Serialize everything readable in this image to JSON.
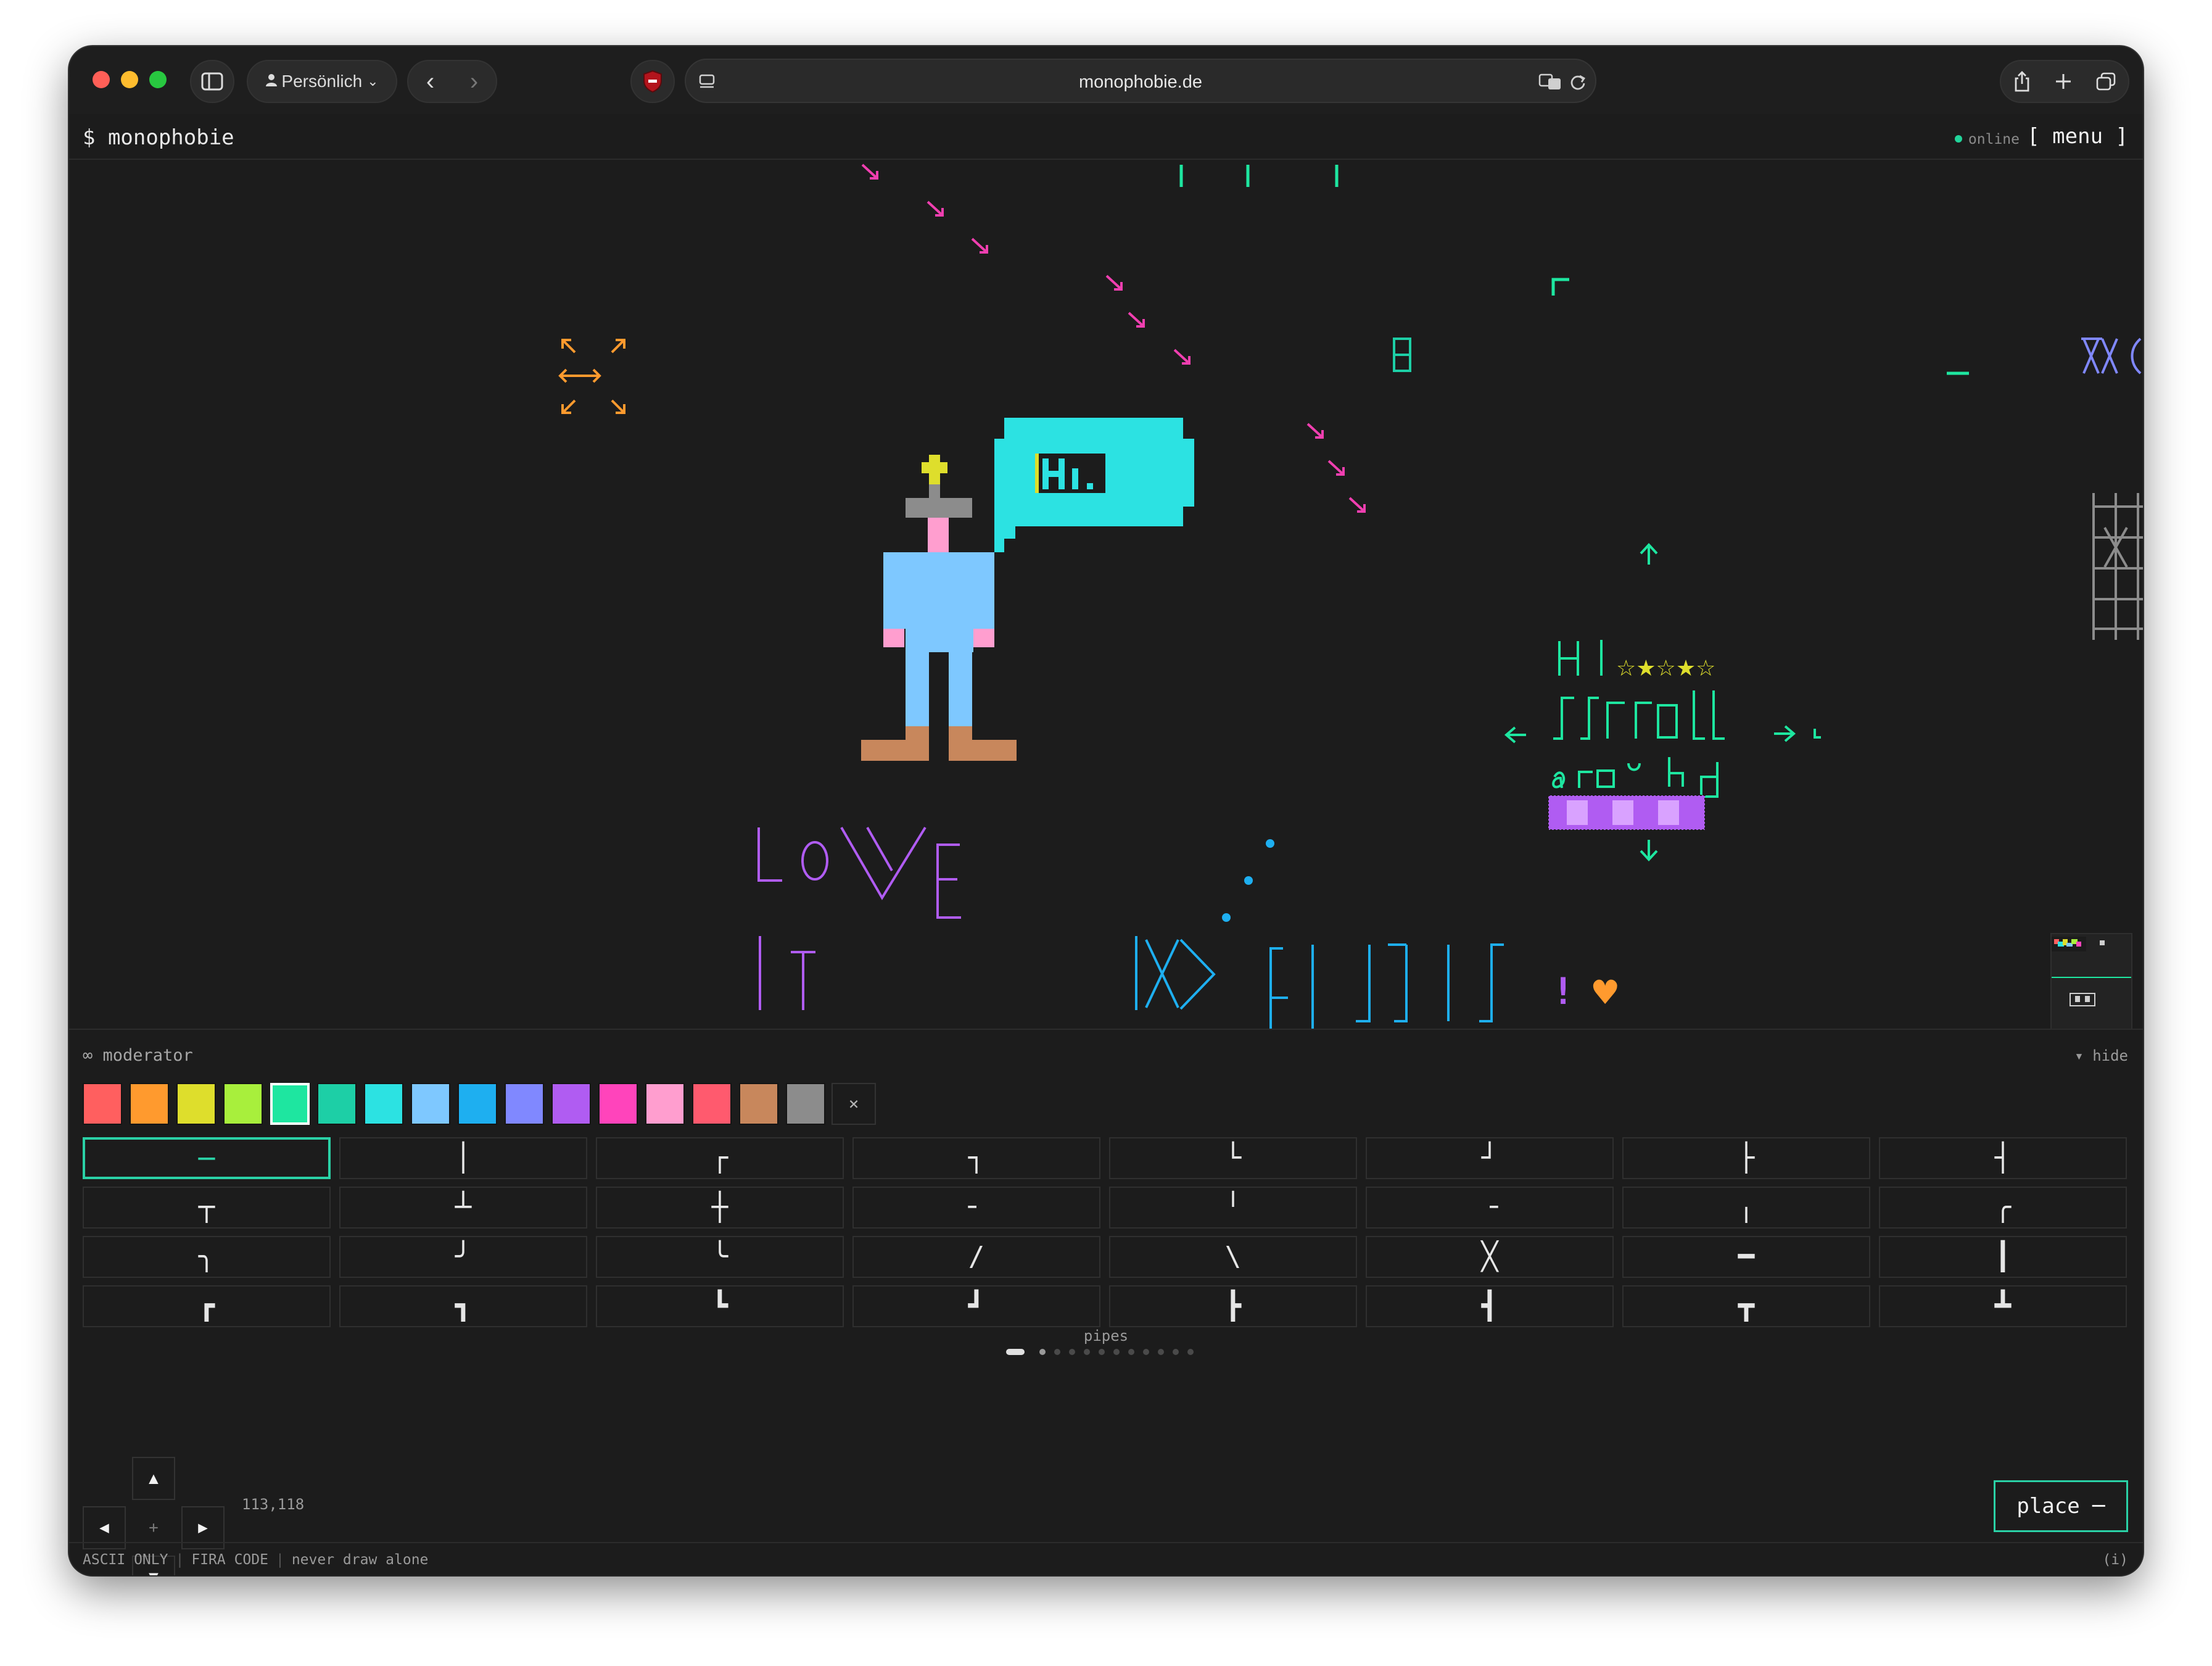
{
  "browser": {
    "profile_label": "Persönlich",
    "url": "monophobie.de"
  },
  "app": {
    "title": "$ monophobie",
    "status": "online",
    "menu_label": "[ menu ]"
  },
  "canvas": {
    "pixel_art_text": "Hi",
    "words": {
      "love_l": "Lo",
      "love_v": "\\/",
      "love_e": "E",
      "it": "IT",
      "hi": "HI",
      "stars": "☆★☆★☆",
      "scroll": "ʃɾɾoll",
      "around": "@ɾ□ᵕbd",
      "xx": "XX()",
      "pipes_text": "|X〉",
      "fiji": "ʃ|ʃ]|ʃ",
      "exclaim": "!",
      "heart": "♥"
    }
  },
  "panel": {
    "mode_label": "∞ moderator",
    "hide_label": "▾ hide",
    "colors": [
      "#ff5f5f",
      "#ff9a2e",
      "#dede2c",
      "#a8ef3c",
      "#1ee6a0",
      "#1dcfa6",
      "#2ce2e2",
      "#7ec8ff",
      "#1eaff0",
      "#8088ff",
      "#b05cf2",
      "#ff44bb",
      "#ff9ecf",
      "#ff5a6e",
      "#c8875c",
      "#8c8c8c"
    ],
    "selected_color_index": 4,
    "clear_label": "×",
    "glyphs": [
      "─",
      "│",
      "┌",
      "┐",
      "└",
      "┘",
      "├",
      "┤",
      "┬",
      "┴",
      "┼",
      "╴",
      "╵",
      "╶",
      "╷",
      "╭",
      "╮",
      "╯",
      "╰",
      "/",
      "\\",
      "╳",
      "━",
      "┃",
      "┏",
      "┓",
      "┗",
      "┛",
      "┣",
      "┫",
      "┳",
      "┻"
    ],
    "selected_glyph_index": 0,
    "page_label": "pipes",
    "page_count": 12,
    "current_page": 0,
    "nav": {
      "up": "▲",
      "down": "▼",
      "left": "◀",
      "right": "▶",
      "center": "+"
    },
    "coordinates": "113,118",
    "place_label": "place ─"
  },
  "footer": {
    "items": [
      "ASCII ONLY",
      "FIRA CODE",
      "never draw alone"
    ],
    "info_label": "(i)"
  }
}
